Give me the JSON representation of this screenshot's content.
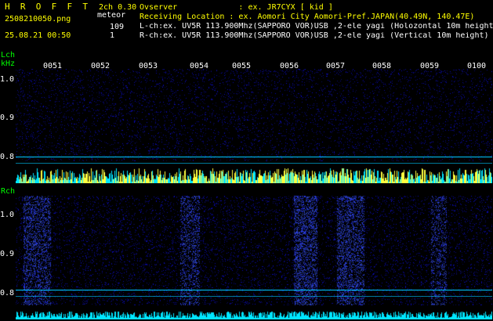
{
  "header": {
    "title_letters": "H  R  O  F  F  T",
    "version": "2ch 0.30",
    "filename": "2508210050.png",
    "meteor_label": "meteor",
    "lch_count": "109",
    "rch_count": "1",
    "datetime": "25.08.21 00:50",
    "observer_line": "Ovserver             : ex. JR7CYX [ kid ]",
    "location_line": "Receiving Location : ex. Aomori City Aomori-Pref.JAPAN(40.49N, 140.47E)",
    "lch_line": "L-ch:ex. UV5R 113.900Mhz(SAPPORO VOR)USB ,2-ele yagi (Holozontal 10m height)",
    "rch_line": "R-ch:ex. UV5R 113.900Mhz(SAPPORO VOR)USB ,2-ele yagi (Vertical 10m height)"
  },
  "lch_panel": {
    "label": "Lch",
    "unit": "kHz",
    "time_ticks": [
      "0051",
      "0052",
      "0053",
      "0054",
      "0055",
      "0056",
      "0057",
      "0058",
      "0059",
      "0100"
    ],
    "freq_ticks": [
      "1.0",
      "0.9",
      "0.8"
    ]
  },
  "rch_panel": {
    "label": "Rch",
    "freq_ticks": [
      "1.0",
      "0.9",
      "0.8"
    ]
  },
  "colors": {
    "background": "#000000",
    "text_white": "#ffffff",
    "text_yellow": "#ffff00",
    "text_green": "#00ff00",
    "marker_line": "#00c8ff",
    "spectrum_base": "#0a0a6e",
    "amplitude_cyan": "#00e5ff",
    "amplitude_yellow": "#ffff40"
  }
}
